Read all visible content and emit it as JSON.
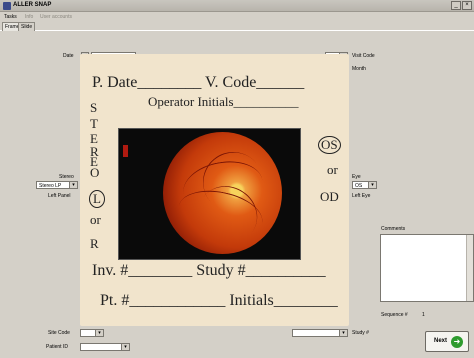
{
  "window": {
    "title": "ALLER SNAP"
  },
  "menu": {
    "items": [
      "Tasks",
      "Info",
      "User accounts"
    ]
  },
  "tabs": [
    "Frame",
    "Slide"
  ],
  "fields": {
    "date_label": "Date",
    "visit_code_label": "Visit Code",
    "month_label": "Month",
    "stereo_label": "Stereo",
    "stereo_value": "Stereo LP",
    "left_panel_label": "Left Panel",
    "eye_label": "Eye",
    "eye_value": "OS",
    "left_eye_label": "Left Eye",
    "comments_label": "Comments",
    "sequence_label": "Sequence #",
    "sequence_value": "1",
    "site_code_label": "Site Code",
    "study_label": "Study #",
    "patient_id_label": "Patient ID"
  },
  "card": {
    "line1": "P. Date________ V. Code______",
    "line2": "Operator Initials__________",
    "stereo_letters": [
      "S",
      "T",
      "E",
      "R",
      "E",
      "O"
    ],
    "left_letters": [
      "L",
      "or",
      "R"
    ],
    "right_letters": [
      "OS",
      "or",
      "OD"
    ],
    "line3": "Inv. #________ Study #__________",
    "line4": "Pt. #____________ Initials________"
  },
  "buttons": {
    "next": "Next",
    "minimize": "_",
    "close": "×"
  },
  "icons": {
    "next": "arrow-right-circle-icon",
    "app": "app-icon"
  }
}
